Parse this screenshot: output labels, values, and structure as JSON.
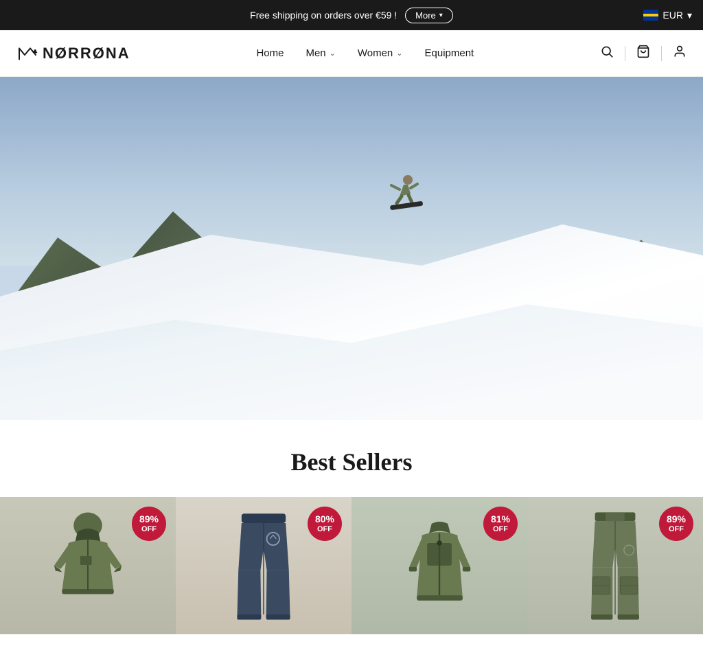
{
  "announcement": {
    "text": "Free shipping on orders over €59 !",
    "more_label": "More",
    "currency_label": "EUR",
    "currency_chevron": "▼"
  },
  "nav": {
    "logo_text": "NØRRØNA",
    "items": [
      {
        "id": "home",
        "label": "Home",
        "has_dropdown": false
      },
      {
        "id": "men",
        "label": "Men",
        "has_dropdown": true
      },
      {
        "id": "women",
        "label": "Women",
        "has_dropdown": true
      },
      {
        "id": "equipment",
        "label": "Equipment",
        "has_dropdown": false
      }
    ]
  },
  "hero": {
    "alt": "Snowboarder on snowy mountain slope"
  },
  "best_sellers": {
    "title": "Best Sellers",
    "products": [
      {
        "id": "p1",
        "badge_percent": "89%",
        "badge_off": "OFF",
        "alt": "Green ski jacket"
      },
      {
        "id": "p2",
        "badge_percent": "80%",
        "badge_off": "OFF",
        "alt": "Dark blue pants"
      },
      {
        "id": "p3",
        "badge_percent": "81%",
        "badge_off": "OFF",
        "alt": "Olive green fleece jacket"
      },
      {
        "id": "p4",
        "badge_percent": "89%",
        "badge_off": "OFF",
        "alt": "Olive green cargo pants"
      }
    ]
  },
  "icons": {
    "search": "🔍",
    "cart": "🛍",
    "user": "👤",
    "chevron_down": "⌄",
    "chevron_down_small": "▾"
  },
  "colors": {
    "accent": "#c0193a",
    "dark": "#1a1a1a",
    "announcement_bg": "#1a1a1a"
  }
}
